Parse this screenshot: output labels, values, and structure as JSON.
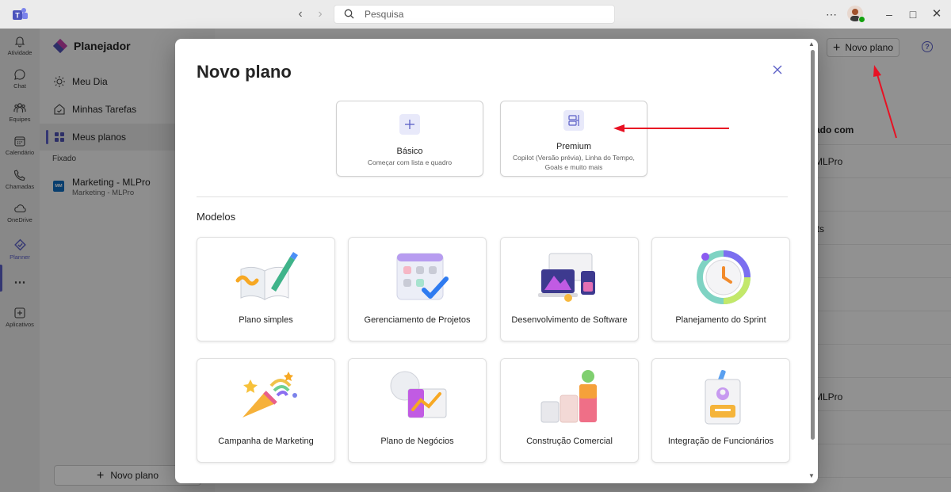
{
  "titlebar": {
    "search_placeholder": "Pesquisa",
    "more_icon": "ellipsis-icon",
    "minimize_icon": "minimize-icon",
    "maximize_icon": "maximize-icon",
    "close_icon": "close-icon"
  },
  "rail": {
    "items": [
      {
        "label": "Atividade",
        "icon": "bell-icon"
      },
      {
        "label": "Chat",
        "icon": "chat-icon"
      },
      {
        "label": "Equipes",
        "icon": "teams-icon"
      },
      {
        "label": "Calendário",
        "icon": "calendar-icon"
      },
      {
        "label": "Chamadas",
        "icon": "phone-icon"
      },
      {
        "label": "OneDrive",
        "icon": "cloud-icon"
      },
      {
        "label": "Planner",
        "icon": "planner-icon"
      },
      {
        "label": "Aplicativos",
        "icon": "add-apps-icon"
      }
    ]
  },
  "sidebar": {
    "title": "Planejador",
    "nav": [
      {
        "label": "Meu Dia",
        "icon": "sun-icon"
      },
      {
        "label": "Minhas Tarefas",
        "icon": "tasks-icon"
      },
      {
        "label": "Meus planos",
        "icon": "grid-icon"
      }
    ],
    "pinned_label": "Fixado",
    "pinned_plan": {
      "badge": "MM",
      "name": "Marketing - MLPro",
      "sub": "Marketing - MLPro"
    },
    "new_plan_label": "Novo plano"
  },
  "main": {
    "new_plan_label": "Novo plano",
    "help_glyph": "?",
    "column_header": "ado com",
    "rows": [
      "MLPro",
      "lts",
      "MLPro"
    ]
  },
  "dialog": {
    "title": "Novo plano",
    "types": [
      {
        "name": "Básico",
        "desc": "Começar com lista e quadro"
      },
      {
        "name": "Premium",
        "desc": "Copilot (Versão prévia), Linha do Tempo, Goals e muito mais"
      }
    ],
    "section_title": "Modelos",
    "templates": [
      {
        "label": "Plano simples"
      },
      {
        "label": "Gerenciamento de Projetos"
      },
      {
        "label": "Desenvolvimento de Software"
      },
      {
        "label": "Planejamento do Sprint"
      },
      {
        "label": "Campanha de Marketing"
      },
      {
        "label": "Plano de Negócios"
      },
      {
        "label": "Construção Comercial"
      },
      {
        "label": "Integração de Funcionários"
      }
    ]
  },
  "colors": {
    "accent": "#5b5fc7",
    "annotation": "#e81123"
  }
}
